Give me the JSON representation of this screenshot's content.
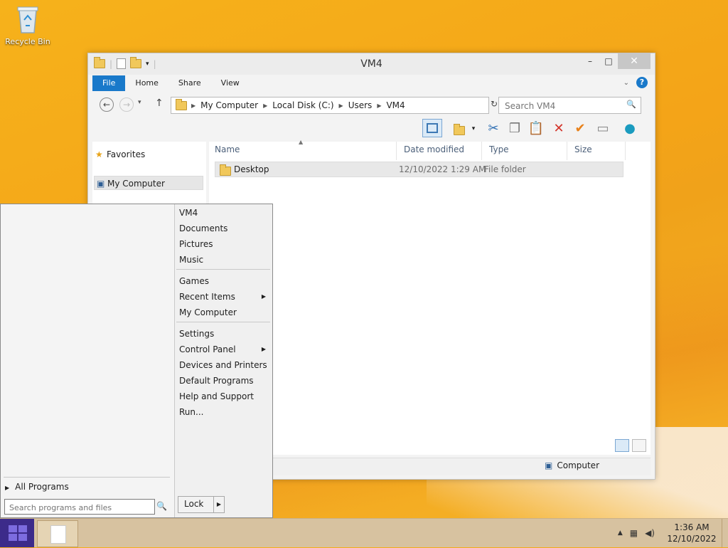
{
  "desktop": {
    "recycle_bin_label": "Recycle Bin"
  },
  "window": {
    "title": "VM4",
    "ribbon_tabs": [
      "File",
      "Home",
      "Share",
      "View"
    ],
    "breadcrumbs": [
      "My Computer",
      "Local Disk (C:)",
      "Users",
      "VM4"
    ],
    "search_placeholder": "Search VM4",
    "nav": {
      "favorites": "Favorites",
      "my_computer": "My Computer"
    },
    "columns": {
      "name": "Name",
      "date_modified": "Date modified",
      "type": "Type",
      "size": "Size"
    },
    "files": [
      {
        "name": "Desktop",
        "date": "12/10/2022 1:29 AM",
        "type": "File folder"
      }
    ],
    "status_location": "Computer"
  },
  "start_menu": {
    "all_programs": "All Programs",
    "search_placeholder": "Search programs and files",
    "group1": [
      "VM4",
      "Documents",
      "Pictures",
      "Music"
    ],
    "group2": [
      "Games",
      "Recent Items",
      "My Computer"
    ],
    "group3": [
      "Settings",
      "Control Panel",
      "Devices and Printers",
      "Default Programs",
      "Help and Support",
      "Run..."
    ],
    "lock_label": "Lock"
  },
  "taskbar": {
    "time": "1:36 AM",
    "date": "12/10/2022"
  },
  "colors": {
    "accent": "#1979ca",
    "start_button": "#3c2b8a",
    "taskbar": "#d7c2a0"
  }
}
